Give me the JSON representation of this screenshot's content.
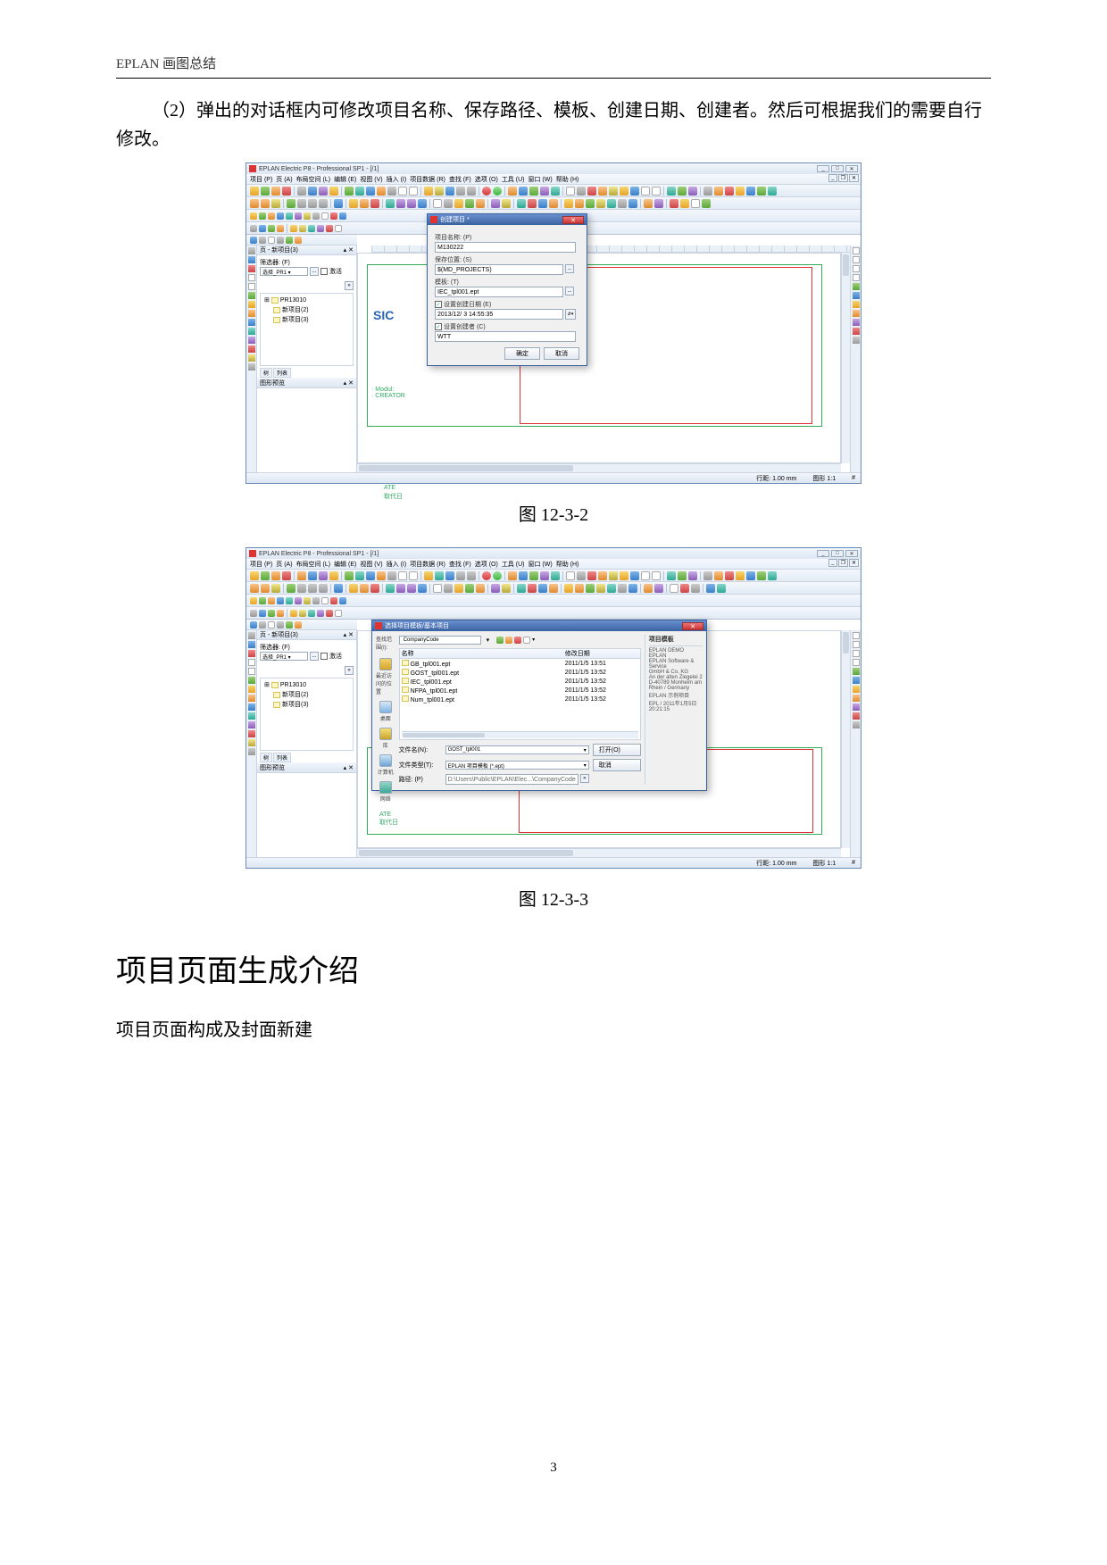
{
  "header": "EPLAN 画图总结",
  "paragraph_2": "（2）弹出的对话框内可修改项目名称、保存路径、模板、创建日期、创建者。然后可根据我们的需要自行修改。",
  "screenshot1": {
    "title": "EPLAN Electric P8 - Professional SP1 - [/1]",
    "menu": [
      "项目 (P)",
      "页 (A)",
      "布局空间 (L)",
      "编辑 (E)",
      "视图 (V)",
      "插入 (I)",
      "项目数据 (R)",
      "查找 (F)",
      "选项 (O)",
      "工具 (U)",
      "窗口 (W)",
      "帮助 (H)"
    ],
    "nav": {
      "header": "页 - 新项目(3)",
      "filter_label": "筛选器: (F)",
      "filter_value": "选择_PR1 ▾",
      "ellipsis": "...",
      "activate_label": "激活",
      "tree": [
        "PR13010",
        "新项目(2)",
        "新项目(3)"
      ],
      "tab1": "树",
      "tab2": "列表",
      "preview_header": "图形预览"
    },
    "canvas_hints": [
      "Modul:",
      "CREATOR",
      "ATE",
      "取代日"
    ],
    "logo": "SIC",
    "dialog": {
      "title": "创建项目 *",
      "name_label": "项目名称: (P)",
      "name_value": "M130222",
      "path_label": "保存位置: (S)",
      "path_value": "$(MD_PROJECTS)",
      "tmpl_label": "模板: (T)",
      "tmpl_value": "IEC_tpl001.ept",
      "date_chk": "设置创建日期 (E)",
      "date_value": "2013/12/ 3  14:55:35",
      "creator_chk": "设置创建者 (C)",
      "creator_value": "WTT",
      "ok": "确定",
      "cancel": "取消",
      "browse": "..."
    },
    "status": {
      "grid": "行距: 1.00 mm",
      "zoom": "图形 1:1",
      "hash": "#"
    }
  },
  "caption1": "图  12-3-2",
  "screenshot2": {
    "title": "EPLAN Electric P8 - Professional SP1 - [/1]",
    "menu": [
      "项目 (P)",
      "页 (A)",
      "布局空间 (L)",
      "编辑 (E)",
      "视图 (V)",
      "插入 (I)",
      "项目数据 (R)",
      "查找 (F)",
      "选项 (O)",
      "工具 (U)",
      "窗口 (W)",
      "帮助 (H)"
    ],
    "nav": {
      "header": "页 - 新项目(3)",
      "filter_label": "筛选器: (F)",
      "filter_value": "选择_PR1 ▾",
      "ellipsis": "...",
      "activate_label": "激活",
      "tree": [
        "PR13010",
        "新项目(2)",
        "新项目(3)"
      ],
      "tab1": "树",
      "tab2": "列表",
      "preview_header": "图形预览"
    },
    "dialog": {
      "title": "选择项目模板/基本项目",
      "scope_label": "查找范围(I):",
      "scope_value": "CompanyCode",
      "col_name": "名称",
      "col_date": "修改日期",
      "files": [
        {
          "name": "GB_tpl001.ept",
          "date": "2011/1/5 13:51"
        },
        {
          "name": "GOST_tpl001.ept",
          "date": "2011/1/5 13:52"
        },
        {
          "name": "IEC_tpl001.ept",
          "date": "2011/1/5 13:52"
        },
        {
          "name": "NFPA_tpl001.ept",
          "date": "2011/1/5 13:52"
        },
        {
          "name": "Num_tpl001.ept",
          "date": "2011/1/5 13:52"
        }
      ],
      "fname_label": "文件名(N):",
      "fname_value": "GOST_tpl001",
      "ftype_label": "文件类型(T):",
      "ftype_value": "EPLAN 项目模板 (*.ept)",
      "path_label": "路径: (P)",
      "path_value": "D:\\Users\\Public\\EPLAN\\Elec...\\CompanyCode",
      "open": "打开(O)",
      "cancel": "取消",
      "places": [
        "最近访问的位置",
        "桌面",
        "库",
        "计算机",
        "网络"
      ],
      "side_header": "项目模板",
      "side_lines": [
        "EPLAN DEMO",
        "EPLAN",
        "EPLAN Software &",
        "Service",
        "GmbH & Co. KG",
        "An der alten Ziegelei 2",
        "D-40789 Monheim am",
        "Rhein / Germany",
        "EPLAN 示例项目",
        "EPL / 2011年1月5日",
        "20:21:15"
      ]
    },
    "status": {
      "grid": "行距: 1.00 mm",
      "zoom": "图形 1:1",
      "hash": "#"
    }
  },
  "caption2": "图 12-3-3",
  "section_head": "项目页面生成介绍",
  "subsection": "项目页面构成及封面新建",
  "page_num": "3",
  "spinner": "⇵▾"
}
